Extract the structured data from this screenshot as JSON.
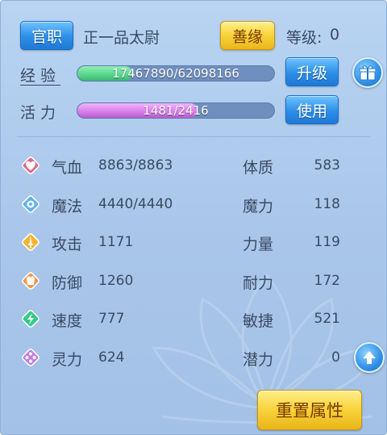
{
  "header": {
    "rank_button": "官职",
    "rank_title": "正一品太尉",
    "karma_button": "善缘",
    "level_label": "等级:",
    "level_value": "0"
  },
  "experience": {
    "label": "经验",
    "current": 17467890,
    "max": 62098166,
    "text": "17467890/62098166",
    "fill_fraction": 0.28,
    "upgrade_button": "升级"
  },
  "vitality": {
    "label": "活力",
    "current": 1481,
    "max": 2416,
    "text": "1481/2416",
    "fill_fraction": 0.61,
    "use_button": "使用"
  },
  "stats_left": [
    {
      "name": "气血",
      "value": "8863/8863",
      "icon": "heart-icon",
      "color": "#e06a86"
    },
    {
      "name": "魔法",
      "value": "4440/4440",
      "icon": "mana-icon",
      "color": "#5fb3ee"
    },
    {
      "name": "攻击",
      "value": "1171",
      "icon": "sword-icon",
      "color": "#f2b632"
    },
    {
      "name": "防御",
      "value": "1260",
      "icon": "armor-icon",
      "color": "#ee9a4a"
    },
    {
      "name": "速度",
      "value": "777",
      "icon": "speed-icon",
      "color": "#33c98a"
    },
    {
      "name": "灵力",
      "value": "624",
      "icon": "spirit-icon",
      "color": "#c07ee0"
    }
  ],
  "stats_right": [
    {
      "name": "体质",
      "value": "583"
    },
    {
      "name": "魔力",
      "value": "118"
    },
    {
      "name": "力量",
      "value": "119"
    },
    {
      "name": "耐力",
      "value": "172"
    },
    {
      "name": "敏捷",
      "value": "521"
    },
    {
      "name": "潜力",
      "value": "0"
    }
  ],
  "reset_button": "重置属性",
  "colors": {
    "exp_fill": "#58d48c",
    "vitality_fill": "#d67ce8"
  }
}
